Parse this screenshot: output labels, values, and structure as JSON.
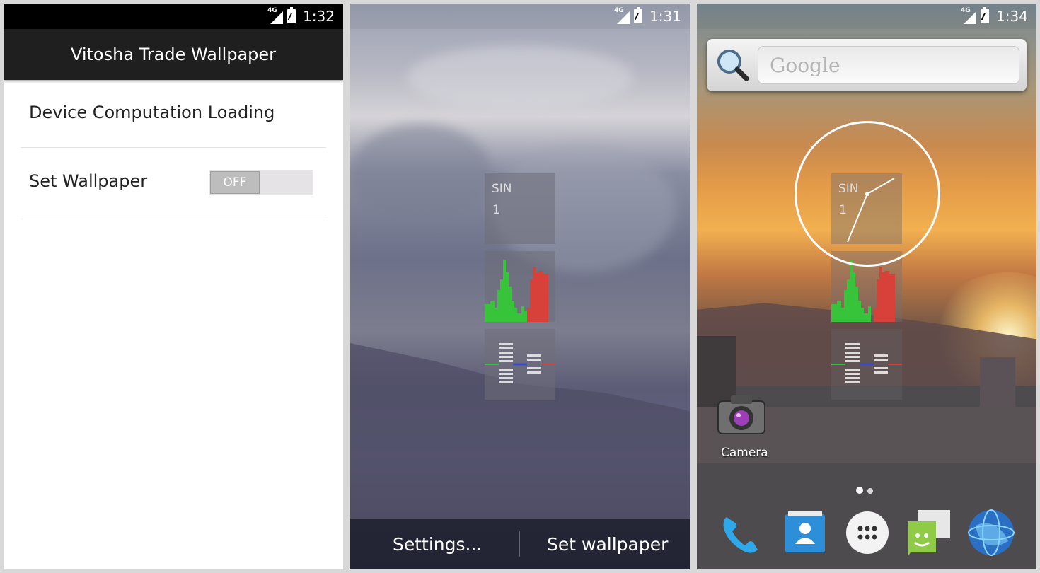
{
  "screens": {
    "settings": {
      "status_time": "1:32",
      "network": "4G",
      "app_title": "Vitosha Trade Wallpaper",
      "prefs": [
        {
          "label": "Device Computation Loading"
        },
        {
          "label": "Set Wallpaper",
          "toggle": "OFF"
        }
      ]
    },
    "preview": {
      "status_time": "1:31",
      "network": "4G",
      "widget_label": "SIN",
      "widget_value": "1",
      "buttons": {
        "settings": "Settings...",
        "set_wallpaper": "Set wallpaper"
      }
    },
    "home": {
      "status_time": "1:34",
      "network": "4G",
      "search_placeholder": "Google",
      "widget_label": "SIN",
      "widget_value": "1",
      "camera_label": "Camera"
    }
  },
  "colors": {
    "accent_green": "#38c43a",
    "accent_red": "#d8403a",
    "accent_blue": "#2d72d7",
    "action_bar": "#1f1f1f"
  }
}
